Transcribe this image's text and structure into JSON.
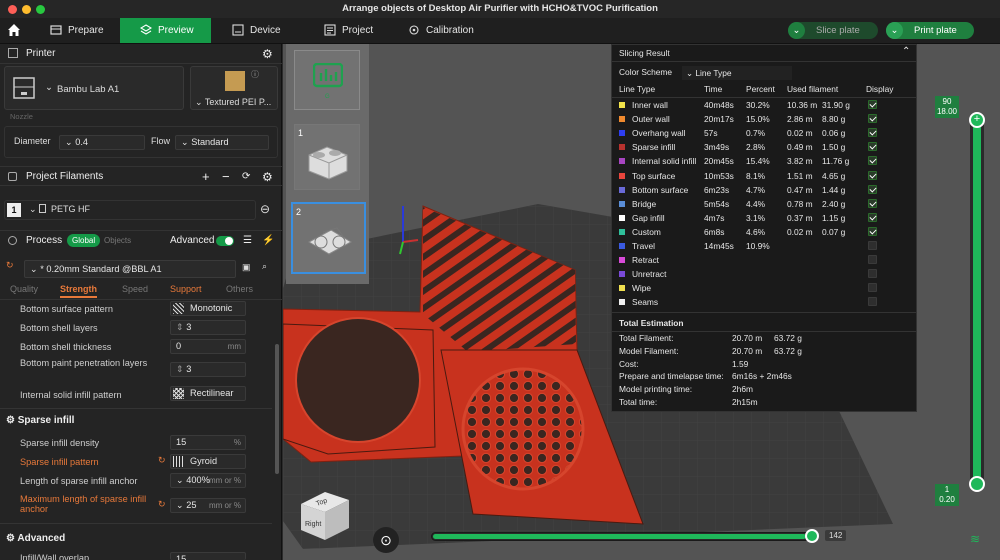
{
  "window": {
    "title": "Arrange objects of Desktop Air Purifier with HCHO&TVOC Purification"
  },
  "nav": {
    "prepare": "Prepare",
    "preview": "Preview",
    "device": "Device",
    "project": "Project",
    "calibration": "Calibration",
    "slice_plate": "Slice plate",
    "print_plate": "Print plate"
  },
  "printer": {
    "header": "Printer",
    "name": "Bambu Lab A1",
    "plate": "Textured PEI P...",
    "nozzle_label": "Nozzle",
    "diameter_label": "Diameter",
    "diameter": "0.4",
    "flow_label": "Flow",
    "flow": "Standard"
  },
  "filaments": {
    "header": "Project Filaments",
    "index": "1",
    "name": "PETG HF"
  },
  "process": {
    "header": "Process",
    "global": "Global",
    "objects": "Objects",
    "advanced": "Advanced",
    "preset": "* 0.20mm Standard @BBL A1",
    "tabs": [
      "Quality",
      "Strength",
      "Speed",
      "Support",
      "Others"
    ]
  },
  "settings": {
    "bottom_surface_pattern_label": "Bottom surface pattern",
    "bottom_surface_pattern": "Monotonic",
    "bottom_shell_layers_label": "Bottom shell layers",
    "bottom_shell_layers": "3",
    "bottom_shell_thickness_label": "Bottom shell thickness",
    "bottom_shell_thickness": "0",
    "mm": "mm",
    "bottom_paint_label": "Bottom paint penetration layers",
    "bottom_paint": "3",
    "internal_solid_label": "Internal solid infill pattern",
    "internal_solid": "Rectilinear",
    "sparse_header": "Sparse infill",
    "sparse_density_label": "Sparse infill density",
    "sparse_density": "15",
    "percent": "%",
    "sparse_pattern_label": "Sparse infill pattern",
    "sparse_pattern": "Gyroid",
    "anchor_label": "Length of sparse infill anchor",
    "anchor": "400%",
    "mm_or_pct": "mm or %",
    "max_anchor_label": "Maximum length of sparse infill anchor",
    "max_anchor": "25",
    "advanced_header": "Advanced",
    "infill_wall_label": "Infill/Wall overlap",
    "infill_wall": "15"
  },
  "plates": [
    "1",
    "2"
  ],
  "gcode_label": "G",
  "viewcube": {
    "top": "Top",
    "right": "Right"
  },
  "slider": {
    "top_value": "90",
    "top_height": "18.00",
    "bottom_value": "1",
    "bottom_height": "0.20",
    "horizontal_value": "142"
  },
  "slicing": {
    "title": "Slicing Result",
    "color_scheme_label": "Color Scheme",
    "color_scheme": "Line Type",
    "headers": [
      "Line Type",
      "Time",
      "Percent",
      "Used filament",
      "Display"
    ],
    "rows": [
      {
        "name": "Inner wall",
        "time": "40m48s",
        "percent": "30.2%",
        "len": "10.36 m",
        "weight": "31.90 g",
        "color": "#f2e34a",
        "on": true
      },
      {
        "name": "Outer wall",
        "time": "20m17s",
        "percent": "15.0%",
        "len": "2.86 m",
        "weight": "8.80 g",
        "color": "#f08a2e",
        "on": true
      },
      {
        "name": "Overhang wall",
        "time": "57s",
        "percent": "0.7%",
        "len": "0.02 m",
        "weight": "0.06 g",
        "color": "#2e3ef0",
        "on": true
      },
      {
        "name": "Sparse infill",
        "time": "3m49s",
        "percent": "2.8%",
        "len": "0.49 m",
        "weight": "1.50 g",
        "color": "#b8322e",
        "on": true
      },
      {
        "name": "Internal solid infill",
        "time": "20m45s",
        "percent": "15.4%",
        "len": "3.82 m",
        "weight": "11.76 g",
        "color": "#a845c2",
        "on": true
      },
      {
        "name": "Top surface",
        "time": "10m53s",
        "percent": "8.1%",
        "len": "1.51 m",
        "weight": "4.65 g",
        "color": "#e8453c",
        "on": true
      },
      {
        "name": "Bottom surface",
        "time": "6m23s",
        "percent": "4.7%",
        "len": "0.47 m",
        "weight": "1.44 g",
        "color": "#6a6ad8",
        "on": true
      },
      {
        "name": "Bridge",
        "time": "5m54s",
        "percent": "4.4%",
        "len": "0.78 m",
        "weight": "2.40 g",
        "color": "#5a8ed8",
        "on": true
      },
      {
        "name": "Gap infill",
        "time": "4m7s",
        "percent": "3.1%",
        "len": "0.37 m",
        "weight": "1.15 g",
        "color": "#ffffff",
        "on": true
      },
      {
        "name": "Custom",
        "time": "6m8s",
        "percent": "4.6%",
        "len": "0.02 m",
        "weight": "0.07 g",
        "color": "#2fbf9a",
        "on": true
      },
      {
        "name": "Travel",
        "time": "14m45s",
        "percent": "10.9%",
        "len": "",
        "weight": "",
        "color": "#3a5ae0",
        "on": false
      },
      {
        "name": "Retract",
        "time": "",
        "percent": "",
        "len": "",
        "weight": "",
        "color": "#d84ad8",
        "on": false
      },
      {
        "name": "Unretract",
        "time": "",
        "percent": "",
        "len": "",
        "weight": "",
        "color": "#7a4ad8",
        "on": false
      },
      {
        "name": "Wipe",
        "time": "",
        "percent": "",
        "len": "",
        "weight": "",
        "color": "#f0e050",
        "on": false
      },
      {
        "name": "Seams",
        "time": "",
        "percent": "",
        "len": "",
        "weight": "",
        "color": "#f0f0f0",
        "on": false
      }
    ],
    "total_header": "Total Estimation",
    "totals": [
      {
        "label": "Total Filament:",
        "a": "20.70 m",
        "b": "63.72 g"
      },
      {
        "label": "Model Filament:",
        "a": "20.70 m",
        "b": "63.72 g"
      },
      {
        "label": "Cost:",
        "a": "1.59",
        "b": ""
      },
      {
        "label": "Prepare and timelapse time:",
        "a": "6m16s + 2m46s",
        "b": ""
      },
      {
        "label": "Model printing time:",
        "a": "2h6m",
        "b": ""
      },
      {
        "label": "Total time:",
        "a": "2h15m",
        "b": ""
      }
    ]
  },
  "colors": {
    "accent": "#159a48",
    "orange": "#e8793a",
    "bed": "#3a3a3a",
    "model": "#c8321e"
  }
}
